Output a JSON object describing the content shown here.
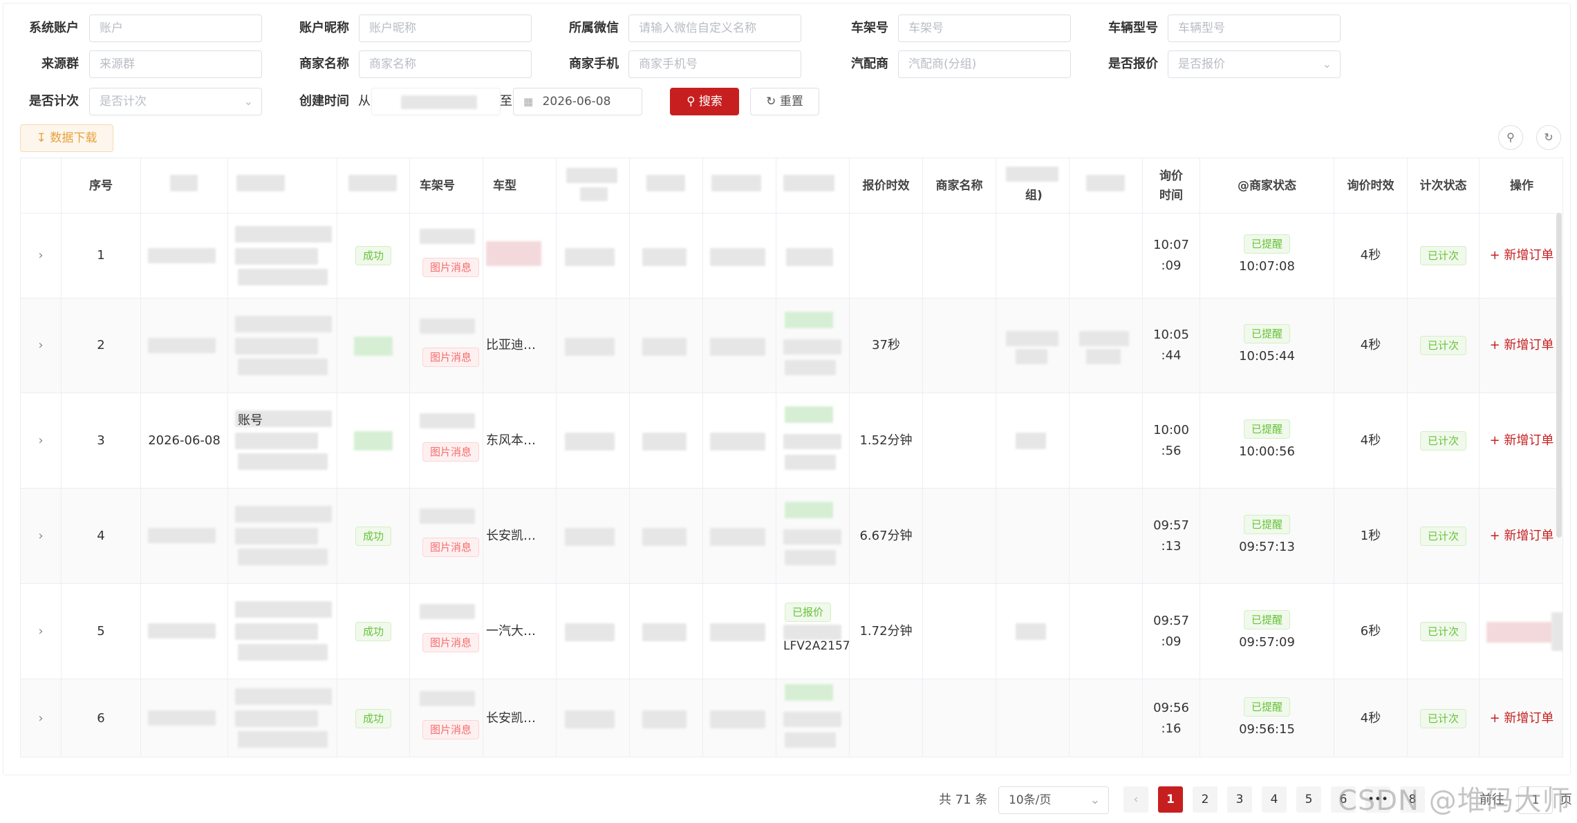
{
  "filters": {
    "system_account": {
      "label": "系统账户",
      "placeholder": "账户"
    },
    "account_nickname": {
      "label": "账户昵称",
      "placeholder": "账户昵称"
    },
    "wechat": {
      "label": "所属微信",
      "placeholder": "请输入微信自定义名称"
    },
    "vin": {
      "label": "车架号",
      "placeholder": "车架号"
    },
    "vehicle_model": {
      "label": "车辆型号",
      "placeholder": "车辆型号"
    },
    "source_group": {
      "label": "来源群",
      "placeholder": "来源群"
    },
    "merchant_name": {
      "label": "商家名称",
      "placeholder": "商家名称"
    },
    "merchant_phone": {
      "label": "商家手机",
      "placeholder": "商家手机号"
    },
    "parts_dealer": {
      "label": "汽配商",
      "placeholder": "汽配商(分组)"
    },
    "is_quoted": {
      "label": "是否报价",
      "placeholder": "是否报价"
    },
    "is_counted": {
      "label": "是否计次",
      "placeholder": "是否计次"
    },
    "created_time": {
      "label": "创建时间",
      "from": "从",
      "to": "至",
      "end_date": "2026-06-08"
    }
  },
  "buttons": {
    "search": "搜索",
    "reset": "重置",
    "download": "数据下载"
  },
  "table": {
    "headers": {
      "index": "序号",
      "vin": "车架号",
      "model": "车型",
      "quote_time": "报价时效",
      "merchant": "商家名称",
      "group_suffix": "组)",
      "inquiry_time": "询价时间",
      "merchant_status": "@商家状态",
      "inquiry_duration": "询价时效",
      "count_status": "计次状态",
      "action": "操作"
    },
    "rows": [
      {
        "index": "1",
        "col2": "",
        "status": "成功",
        "img_tag": "图片消息",
        "model": "",
        "quote_tag": "",
        "quote_time": "",
        "quote_extra": "",
        "inquiry_time": "10:07\n:09",
        "merchant_tag": "已提醒",
        "merchant_time": "10:07:08",
        "duration": "4秒",
        "count_tag": "已计次",
        "action": "新增订单",
        "account_prefix": ""
      },
      {
        "index": "2",
        "col2": "",
        "status": "",
        "img_tag": "图片消息",
        "model": "比亚迪…",
        "quote_tag": "",
        "quote_time": "37秒",
        "quote_extra": "",
        "inquiry_time": "10:05\n:44",
        "merchant_tag": "已提醒",
        "merchant_time": "10:05:44",
        "duration": "4秒",
        "count_tag": "已计次",
        "action": "新增订单",
        "account_prefix": ""
      },
      {
        "index": "3",
        "col2": "2026-06-08",
        "status": "",
        "img_tag": "图片消息",
        "model": "东风本…",
        "quote_tag": "",
        "quote_time": "1.52分钟",
        "quote_extra": "",
        "inquiry_time": "10:00\n:56",
        "merchant_tag": "已提醒",
        "merchant_time": "10:00:56",
        "duration": "4秒",
        "count_tag": "已计次",
        "action": "新增订单",
        "account_prefix": "账号"
      },
      {
        "index": "4",
        "col2": "",
        "status": "成功",
        "img_tag": "图片消息",
        "model": "长安凯…",
        "quote_tag": "",
        "quote_time": "6.67分钟",
        "quote_extra": "",
        "inquiry_time": "09:57\n:13",
        "merchant_tag": "已提醒",
        "merchant_time": "09:57:13",
        "duration": "1秒",
        "count_tag": "已计次",
        "action": "新增订单",
        "account_prefix": ""
      },
      {
        "index": "5",
        "col2": "",
        "status": "成功",
        "img_tag": "图片消息",
        "model": "一汽大…",
        "quote_tag": "已报价",
        "quote_time": "1.72分钟",
        "quote_extra": "LFV2A2157",
        "inquiry_time": "09:57\n:09",
        "merchant_tag": "已提醒",
        "merchant_time": "09:57:09",
        "duration": "6秒",
        "count_tag": "已计次",
        "action": "",
        "account_prefix": ""
      },
      {
        "index": "6",
        "col2": "",
        "status": "成功",
        "img_tag": "图片消息",
        "model": "长安凯…",
        "quote_tag": "",
        "quote_time": "",
        "quote_extra": "",
        "inquiry_time": "09:56\n:16",
        "merchant_tag": "已提醒",
        "merchant_time": "09:56:15",
        "duration": "4秒",
        "count_tag": "已计次",
        "action": "新增订单",
        "account_prefix": ""
      }
    ]
  },
  "pagination": {
    "total": "共 71 条",
    "page_size": "10条/页",
    "pages": [
      "1",
      "2",
      "3",
      "4",
      "5",
      "6",
      "•••",
      "8"
    ],
    "prev": "‹",
    "goto_label": "前往",
    "goto_value": "1",
    "page_suffix": "页"
  },
  "watermark": "CSDN @堆码大师",
  "colors": {
    "primary": "#c71f1f",
    "success": "#67c23a",
    "danger": "#f56c6c",
    "warning": "#e6a23c"
  }
}
